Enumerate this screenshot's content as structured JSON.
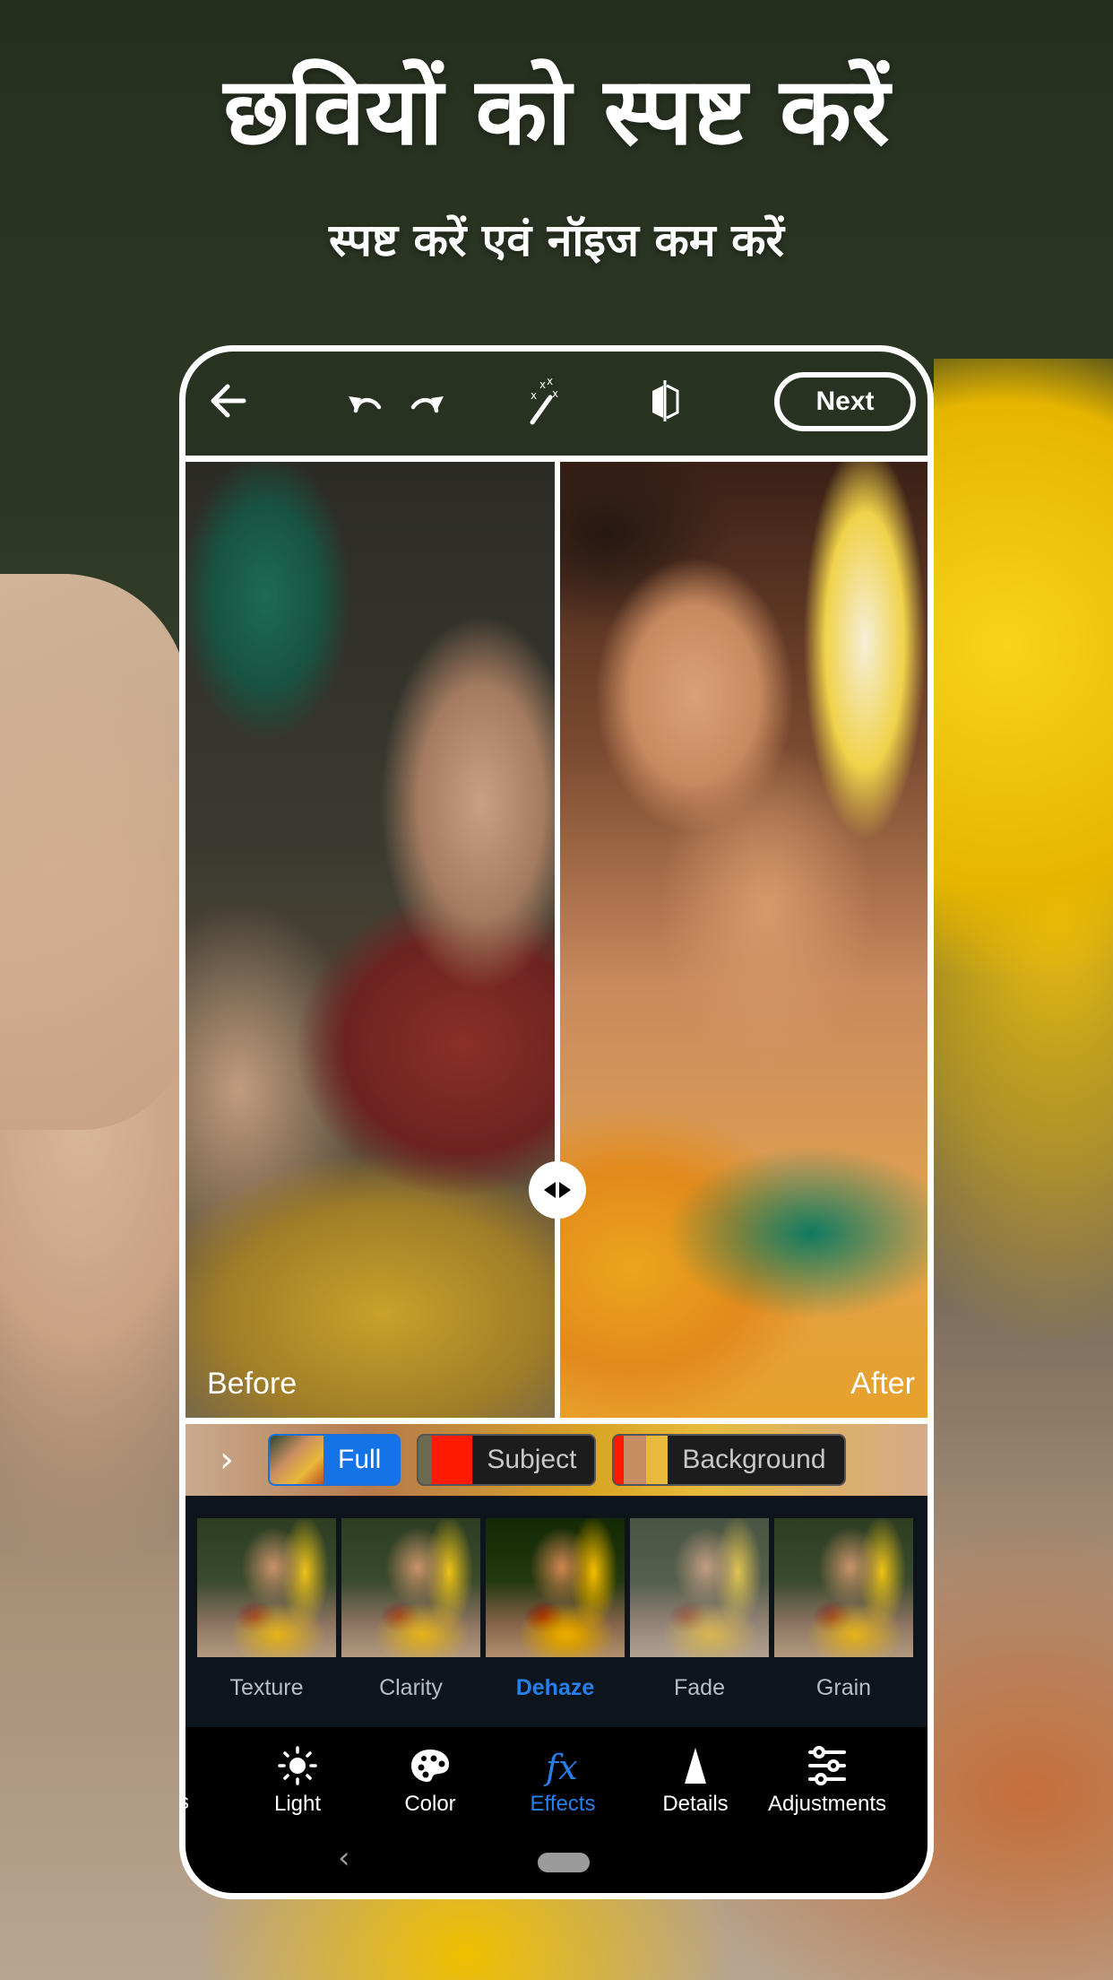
{
  "headline": "छवियों को स्पष्ट करें",
  "subheadline": "स्पष्ट करें एवं नॉइज कम करें",
  "toolbar": {
    "back_icon": "arrow-left-icon",
    "undo_icon": "undo-icon",
    "redo_icon": "redo-icon",
    "auto_icon": "magic-wand-icon",
    "compare_icon": "compare-split-icon",
    "next_label": "Next"
  },
  "compare": {
    "before_label": "Before",
    "after_label": "After",
    "handle_icon": "split-handle-icon"
  },
  "mask_selector": {
    "expand_icon": "chevron-right-icon",
    "options": [
      {
        "label": "Full",
        "active": true
      },
      {
        "label": "Subject",
        "active": false
      },
      {
        "label": "Background",
        "active": false
      }
    ]
  },
  "effects": {
    "items": [
      {
        "label": "Texture",
        "active": false
      },
      {
        "label": "Clarity",
        "active": false
      },
      {
        "label": "Dehaze",
        "active": true
      },
      {
        "label": "Fade",
        "active": false
      },
      {
        "label": "Grain",
        "active": false
      }
    ]
  },
  "tools": {
    "partial_label": "s",
    "items": [
      {
        "label": "Light",
        "icon": "sun-icon",
        "active": false
      },
      {
        "label": "Color",
        "icon": "palette-icon",
        "active": false
      },
      {
        "label": "Effects",
        "icon": "fx-icon",
        "active": true
      },
      {
        "label": "Details",
        "icon": "triangle-detail-icon",
        "active": false
      },
      {
        "label": "Adjustments",
        "icon": "sliders-icon",
        "active": false
      }
    ]
  },
  "system_nav": {
    "back_icon": "nav-back-icon",
    "home_icon": "home-pill-icon"
  },
  "colors": {
    "accent": "#2680eb",
    "chip_active": "#1473e6",
    "panel_bg": "#0e141b",
    "nav_bg": "#000000"
  }
}
